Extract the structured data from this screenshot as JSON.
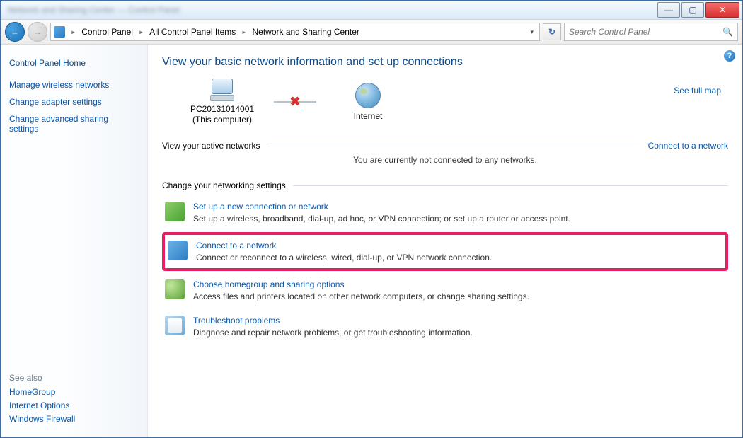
{
  "window": {
    "title_blur": "Network and Sharing Center — Control Panel",
    "btn_min": "—",
    "btn_max": "▢",
    "btn_close": "✕"
  },
  "nav": {
    "back": "←",
    "fwd": "→",
    "refresh": "↻"
  },
  "breadcrumb": {
    "a": "Control Panel",
    "b": "All Control Panel Items",
    "c": "Network and Sharing Center",
    "drop": "▾",
    "sep": "▸"
  },
  "search": {
    "placeholder": "Search Control Panel",
    "icon": "🔍"
  },
  "sidebar": {
    "home": "Control Panel Home",
    "tasks": {
      "a": "Manage wireless networks",
      "b": "Change adapter settings",
      "c": "Change advanced sharing settings"
    },
    "see_also_hdr": "See also",
    "see_also": {
      "a": "HomeGroup",
      "b": "Internet Options",
      "c": "Windows Firewall"
    }
  },
  "content": {
    "help": "?",
    "h1": "View your basic network information and set up connections",
    "full_map": "See full map",
    "node_pc": "PC20131014001",
    "node_pc_sub": "(This computer)",
    "node_internet": "Internet",
    "active_hdr": "View your active networks",
    "connect_link": "Connect to a network",
    "not_connected": "You are currently not connected to any networks.",
    "change_hdr": "Change your networking settings",
    "opts": {
      "setup": {
        "title": "Set up a new connection or network",
        "desc": "Set up a wireless, broadband, dial-up, ad hoc, or VPN connection; or set up a router or access point."
      },
      "connect": {
        "title": "Connect to a network",
        "desc": "Connect or reconnect to a wireless, wired, dial-up, or VPN network connection."
      },
      "homegrp": {
        "title": "Choose homegroup and sharing options",
        "desc": "Access files and printers located on other network computers, or change sharing settings."
      },
      "trouble": {
        "title": "Troubleshoot problems",
        "desc": "Diagnose and repair network problems, or get troubleshooting information."
      }
    }
  }
}
